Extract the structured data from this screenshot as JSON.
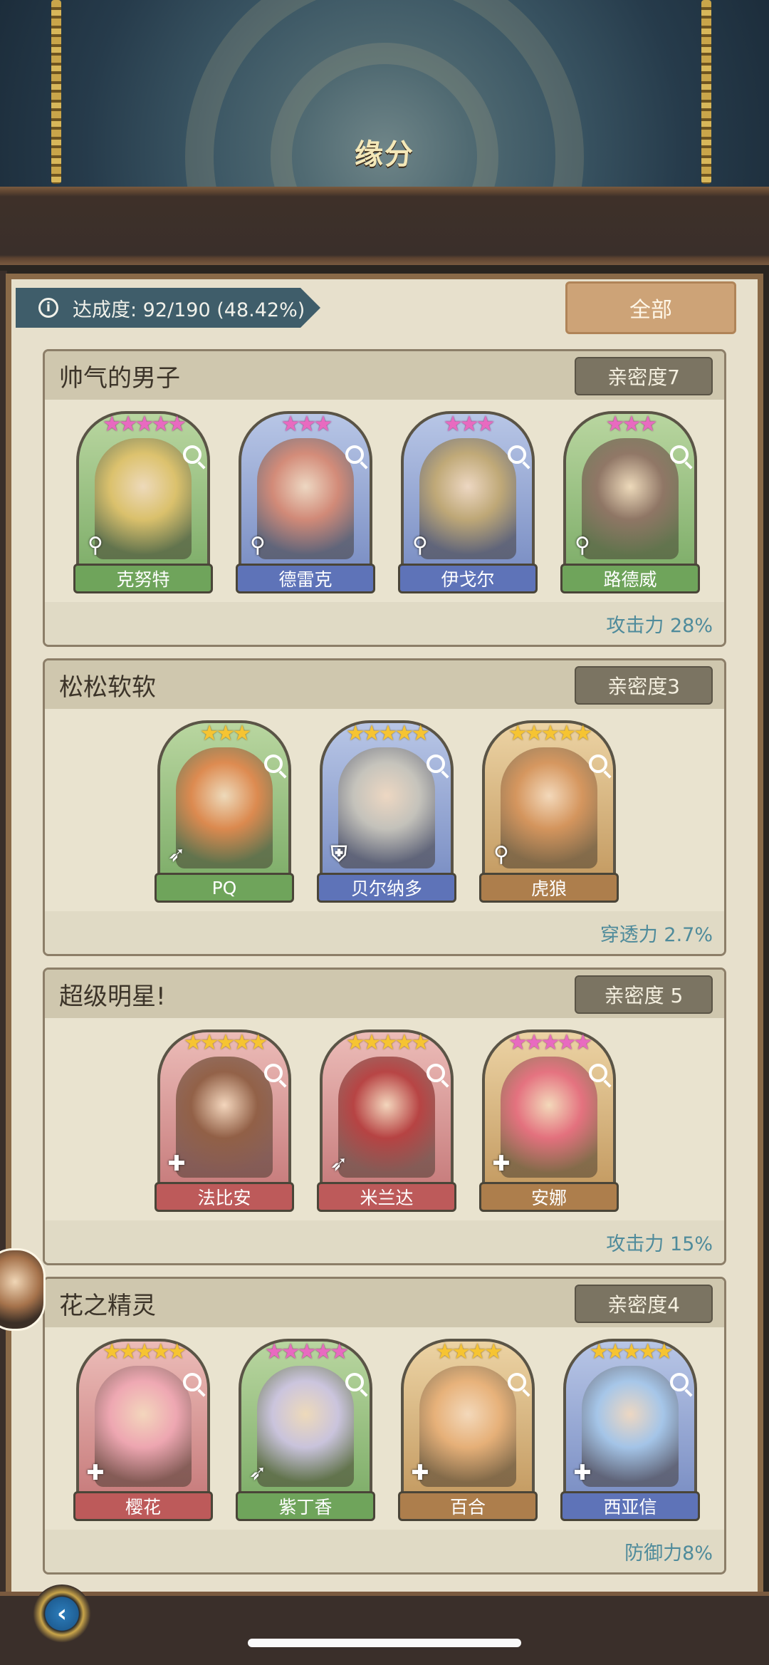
{
  "header": {
    "title": "缘分"
  },
  "toolbar": {
    "progress_text": "达成度: 92/190 (48.42%)",
    "filter_label": "全部"
  },
  "groups": [
    {
      "name": "帅气的男子",
      "intimacy": "亲密度7",
      "bonus": "攻击力 28%",
      "cards": [
        {
          "name": "克努特",
          "stars": "★★★★★",
          "star_color": "pink",
          "role_icon": "sword-icon",
          "role": "⚲"
        },
        {
          "name": "德雷克",
          "stars": "★★★",
          "star_color": "pink",
          "role_icon": "sword-icon",
          "role": "⚲"
        },
        {
          "name": "伊戈尔",
          "stars": "★★★",
          "star_color": "pink",
          "role_icon": "sword-icon",
          "role": "⚲"
        },
        {
          "name": "路德威",
          "stars": "★★★",
          "star_color": "pink",
          "role_icon": "sword-icon",
          "role": "⚲"
        }
      ]
    },
    {
      "name": "松松软软",
      "intimacy": "亲密度3",
      "bonus": "穿透力 2.7%",
      "cards": [
        {
          "name": "PQ",
          "stars": "★★★",
          "star_color": "gold",
          "role_icon": "bow-icon",
          "role": "➶"
        },
        {
          "name": "贝尔纳多",
          "stars": "★★★★★",
          "star_color": "gold",
          "role_icon": "shield-icon",
          "role": "⛨"
        },
        {
          "name": "虎狼",
          "stars": "★★★★★",
          "star_color": "gold",
          "role_icon": "sword-icon",
          "role": "⚲"
        }
      ]
    },
    {
      "name": "超级明星!",
      "intimacy": "亲密度 5",
      "bonus": "攻击力 15%",
      "cards": [
        {
          "name": "法比安",
          "stars": "★★★★★",
          "star_color": "gold",
          "role_icon": "healer-cross-icon",
          "role": "✚"
        },
        {
          "name": "米兰达",
          "stars": "★★★★★",
          "star_color": "gold",
          "role_icon": "bow-icon",
          "role": "➶"
        },
        {
          "name": "安娜",
          "stars": "★★★★★",
          "star_color": "pink",
          "role_icon": "healer-cross-icon",
          "role": "✚"
        }
      ]
    },
    {
      "name": "花之精灵",
      "intimacy": "亲密度4",
      "bonus": "防御力8%",
      "cards": [
        {
          "name": "樱花",
          "stars": "★★★★★",
          "star_color": "gold",
          "role_icon": "healer-cross-icon",
          "role": "✚"
        },
        {
          "name": "紫丁香",
          "stars": "★★★★★",
          "star_color": "pink",
          "role_icon": "bow-icon",
          "role": "➶"
        },
        {
          "name": "百合",
          "stars": "★★★★",
          "star_color": "gold",
          "role_icon": "healer-cross-icon",
          "role": "✚"
        },
        {
          "name": "西亚信",
          "stars": "★★★★★",
          "star_color": "gold",
          "role_icon": "healer-cross-icon",
          "role": "✚"
        }
      ]
    }
  ],
  "nav": {
    "back_icon": "chevron-left-icon",
    "back_glyph": "‹"
  }
}
